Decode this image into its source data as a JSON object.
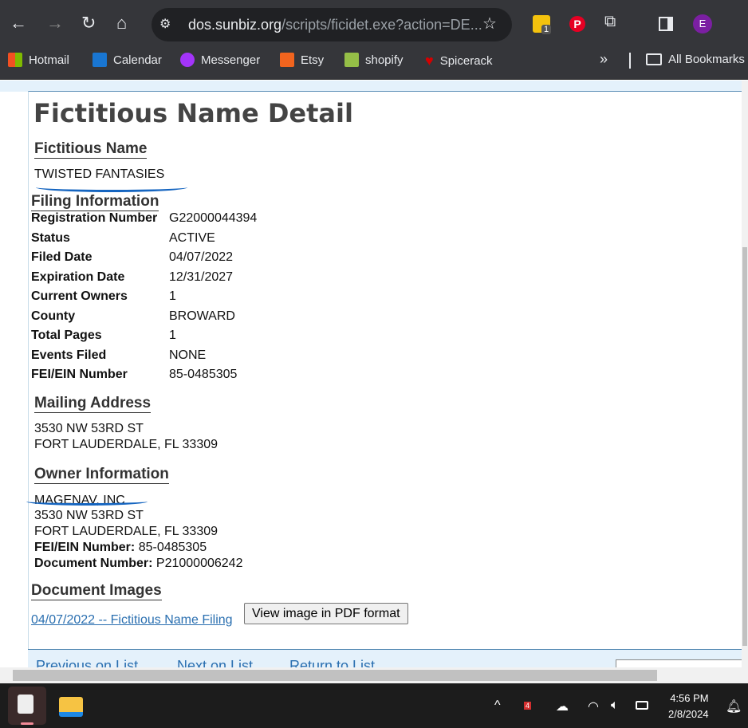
{
  "browser": {
    "url_domain": "dos.sunbiz.org",
    "url_rest": "/scripts/ficidet.exe?action=DE...",
    "extension_badge": "1",
    "profile_initial": "E",
    "bookmarks": [
      "Hotmail",
      "Calendar",
      "Messenger",
      "Etsy",
      "shopify",
      "Spicerack"
    ],
    "more": "»",
    "all_bookmarks": "All Bookmarks"
  },
  "page": {
    "title": "Fictitious Name Detail",
    "fictitious_name_heading": "Fictitious Name",
    "fictitious_name": "TWISTED FANTASIES",
    "filing_heading": "Filing Information",
    "filing": [
      {
        "label": "Registration Number",
        "value": "G22000044394"
      },
      {
        "label": "Status",
        "value": "ACTIVE"
      },
      {
        "label": "Filed Date",
        "value": "04/07/2022"
      },
      {
        "label": "Expiration Date",
        "value": "12/31/2027"
      },
      {
        "label": "Current Owners",
        "value": "1"
      },
      {
        "label": "County",
        "value": "BROWARD"
      },
      {
        "label": "Total Pages",
        "value": "1"
      },
      {
        "label": "Events Filed",
        "value": "NONE"
      },
      {
        "label": "FEI/EIN Number",
        "value": "85-0485305"
      }
    ],
    "mailing_heading": "Mailing Address",
    "mailing": [
      "3530 NW 53RD ST",
      "FORT LAUDERDALE, FL 33309"
    ],
    "owner_heading": "Owner Information",
    "owner_name": "MAGENAV, INC",
    "owner_address": [
      "3530 NW 53RD ST",
      "FORT LAUDERDALE, FL 33309"
    ],
    "owner_fei_label": "FEI/EIN Number:",
    "owner_fei": "85-0485305",
    "owner_doc_label": "Document Number:",
    "owner_doc": "P21000006242",
    "images_heading": "Document Images",
    "image_link": "04/07/2022 -- Fictitious Name Filing",
    "pdf_button": "View image in PDF format",
    "footer_nav": [
      "Previous on List",
      "Next on List",
      "Return to List"
    ]
  },
  "taskbar": {
    "time": "4:56 PM",
    "date": "2/8/2024",
    "notif_badge": "4"
  }
}
